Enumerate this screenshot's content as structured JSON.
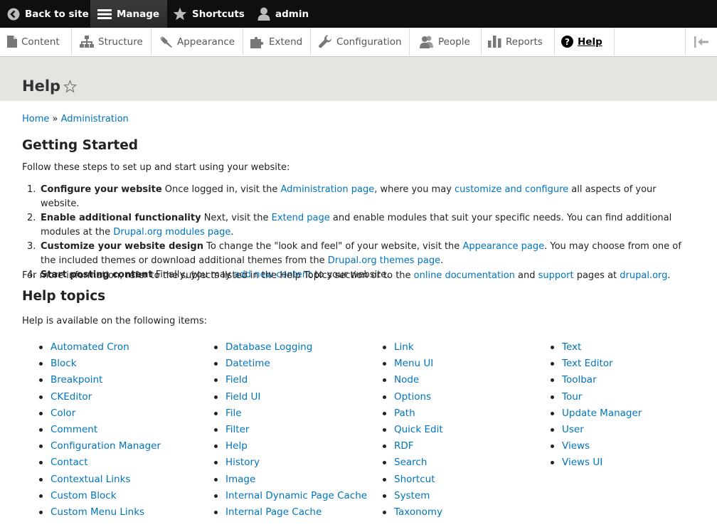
{
  "toolbar": {
    "back_label": "Back to site",
    "manage_label": "Manage",
    "shortcuts_label": "Shortcuts",
    "user_label": "admin"
  },
  "tray": {
    "items": [
      "Content",
      "Structure",
      "Appearance",
      "Extend",
      "Configuration",
      "People",
      "Reports",
      "Help"
    ]
  },
  "page": {
    "title": "Help"
  },
  "breadcrumb": {
    "home": "Home",
    "sep": "»",
    "admin": "Administration"
  },
  "getting_started": {
    "title": "Getting Started",
    "intro": "Follow these steps to set up and start using your website:",
    "steps": [
      {
        "num": "1.",
        "bold": "Configure your website",
        "t1": " Once logged in, visit the ",
        "l1": "Administration page",
        "t2": ", where you may ",
        "l2": "customize and configure",
        "t3": " all aspects of your website."
      },
      {
        "num": "2.",
        "bold": "Enable additional functionality",
        "t1": " Next, visit the ",
        "l1": "Extend page",
        "t2": " and enable modules that suit your specific needs. You can find additional modules at the ",
        "l2": "Drupal.org modules page",
        "t3": "."
      },
      {
        "num": "3.",
        "bold": "Customize your website design",
        "t1": " To change the \"look and feel\" of your website, visit the ",
        "l1": "Appearance page",
        "t2": ". You may choose from one of the included themes or download additional themes from the ",
        "l2": "Drupal.org themes page",
        "t3": "."
      },
      {
        "num": "4.",
        "bold": "Start posting content",
        "t1": " Finally, you may ",
        "l1": "add new content",
        "t2": " to your website."
      }
    ],
    "more_info": {
      "t1": "For more information, refer to the subjects listed in the Help Topics section or to the ",
      "l1": "online documentation",
      "t2": " and ",
      "l2": "support",
      "t3": " pages at ",
      "l3": "drupal.org",
      "t4": "."
    }
  },
  "help_topics": {
    "title": "Help topics",
    "intro": "Help is available on the following items:",
    "col1": [
      "Automated Cron",
      "Block",
      "Breakpoint",
      "CKEditor",
      "Color",
      "Comment",
      "Configuration Manager",
      "Contact",
      "Contextual Links",
      "Custom Block",
      "Custom Menu Links"
    ],
    "col2": [
      "Database Logging",
      "Datetime",
      "Field",
      "Field UI",
      "File",
      "Filter",
      "Help",
      "History",
      "Image",
      "Internal Dynamic Page Cache",
      "Internal Page Cache"
    ],
    "col3": [
      "Link",
      "Menu UI",
      "Node",
      "Options",
      "Path",
      "Quick Edit",
      "RDF",
      "Search",
      "Shortcut",
      "System",
      "Taxonomy"
    ],
    "col4": [
      "Text",
      "Text Editor",
      "Toolbar",
      "Tour",
      "Update Manager",
      "User",
      "Views",
      "Views UI"
    ]
  }
}
